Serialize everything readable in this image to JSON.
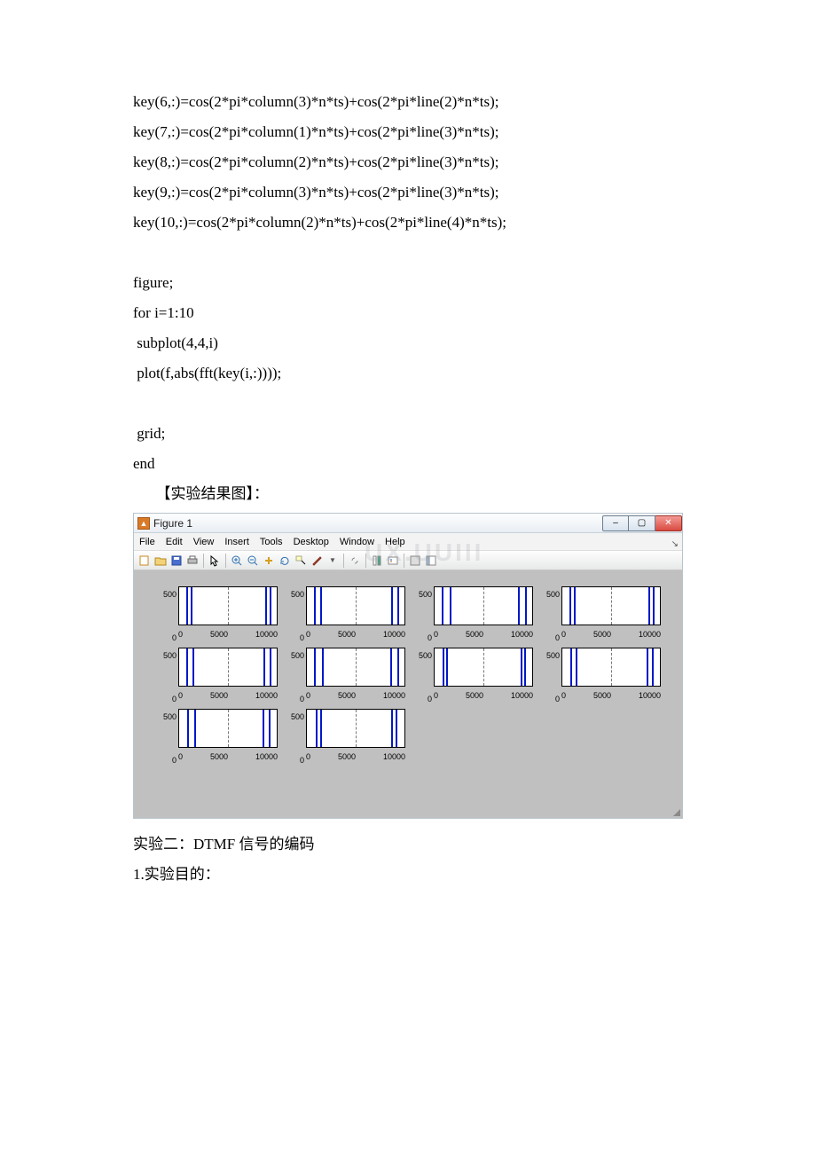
{
  "code_lines": [
    "key(6,:)=cos(2*pi*column(3)*n*ts)+cos(2*pi*line(2)*n*ts);",
    "key(7,:)=cos(2*pi*column(1)*n*ts)+cos(2*pi*line(3)*n*ts);",
    "key(8,:)=cos(2*pi*column(2)*n*ts)+cos(2*pi*line(3)*n*ts);",
    "key(9,:)=cos(2*pi*column(3)*n*ts)+cos(2*pi*line(3)*n*ts);",
    "key(10,:)=cos(2*pi*column(2)*n*ts)+cos(2*pi*line(4)*n*ts);",
    "",
    "figure;",
    "for i=1:10",
    " subplot(4,4,i)",
    " plot(f,abs(fft(key(i,:))));",
    "",
    " grid;",
    "end"
  ],
  "result_heading": "【实验结果图】：",
  "figwin": {
    "title": "Figure 1",
    "min": "–",
    "max": "▢",
    "close": "✕",
    "menu": [
      "File",
      "Edit",
      "View",
      "Insert",
      "Tools",
      "Desktop",
      "Window",
      "Help"
    ],
    "watermark": "UX.UUIII"
  },
  "exp2_title": "实验二：DTMF 信号的编码",
  "exp2_sec": "1.实验目的：",
  "chart_data": {
    "layout": "4x4 subplot, 10 populated",
    "xlim": [
      0,
      10000
    ],
    "ylim": [
      0,
      500
    ],
    "xticks": [
      "0",
      "5000",
      "10000"
    ],
    "yticks": [
      "500",
      "0"
    ],
    "note": "Each subplot shows |FFT| of a DTMF key signal: two narrow peaks near the low end and their mirrored pair near the high end (symmetric FFT magnitude).",
    "subplots": [
      {
        "pos": 1,
        "peaks_x": [
          700,
          1200,
          8800,
          9300
        ]
      },
      {
        "pos": 2,
        "peaks_x": [
          700,
          1350,
          8650,
          9300
        ]
      },
      {
        "pos": 3,
        "peaks_x": [
          700,
          1500,
          8500,
          9300
        ]
      },
      {
        "pos": 4,
        "peaks_x": [
          770,
          1200,
          8800,
          9230
        ]
      },
      {
        "pos": 5,
        "peaks_x": [
          770,
          1350,
          8650,
          9230
        ]
      },
      {
        "pos": 6,
        "peaks_x": [
          770,
          1500,
          8500,
          9230
        ]
      },
      {
        "pos": 7,
        "peaks_x": [
          850,
          1200,
          8800,
          9150
        ]
      },
      {
        "pos": 8,
        "peaks_x": [
          850,
          1350,
          8650,
          9150
        ]
      },
      {
        "pos": 9,
        "peaks_x": [
          850,
          1500,
          8500,
          9150
        ]
      },
      {
        "pos": 10,
        "peaks_x": [
          940,
          1350,
          8650,
          9060
        ]
      }
    ]
  }
}
